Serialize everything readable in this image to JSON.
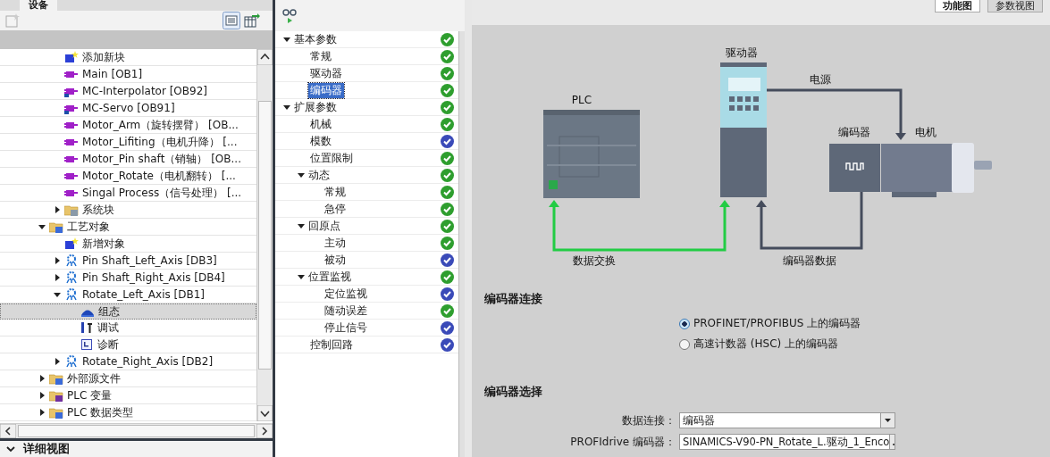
{
  "left_panel": {
    "tab": {
      "label": "设备",
      "selected": true
    },
    "tree": {
      "scrolled_children": [
        {
          "kind": "new-block",
          "label": "添加新块",
          "selected": false
        },
        {
          "kind": "ob",
          "label": "Main [OB1]",
          "selected": false
        },
        {
          "kind": "ob-locked",
          "label": "MC-Interpolator [OB92]",
          "selected": false
        },
        {
          "kind": "ob-locked",
          "label": "MC-Servo [OB91]",
          "selected": false
        },
        {
          "kind": "ob",
          "label": "Motor_Arm（旋转摆臂） [OB...",
          "selected": false
        },
        {
          "kind": "ob",
          "label": "Motor_Lifiting（电机升降） [...",
          "selected": false
        },
        {
          "kind": "ob",
          "label": "Motor_Pin shaft（销轴） [OB...",
          "selected": false
        },
        {
          "kind": "ob",
          "label": "Motor_Rotate（电机翻转） [...",
          "selected": false
        },
        {
          "kind": "ob",
          "label": "Singal Process（信号处理） [...",
          "selected": false
        },
        {
          "kind": "folder-system",
          "label": "系统块",
          "expanded": false,
          "selected": false
        }
      ],
      "items": [
        {
          "kind": "folder-tech",
          "label": "工艺对象",
          "expanded": true,
          "selected": false,
          "children": [
            {
              "kind": "new-object",
              "label": "新增对象",
              "selected": false
            },
            {
              "kind": "axis",
              "label": "Pin Shaft_Left_Axis [DB3]",
              "expanded": false,
              "selected": false
            },
            {
              "kind": "axis",
              "label": "Pin Shaft_Right_Axis [DB4]",
              "expanded": false,
              "selected": false
            },
            {
              "kind": "axis",
              "label": "Rotate_Left_Axis [DB1]",
              "expanded": true,
              "selected": false,
              "children": [
                {
                  "kind": "config",
                  "label": "组态",
                  "selected": true
                },
                {
                  "kind": "commission",
                  "label": "调试",
                  "selected": false
                },
                {
                  "kind": "diagnostics",
                  "label": "诊断",
                  "selected": false
                }
              ]
            },
            {
              "kind": "axis",
              "label": "Rotate_Right_Axis [DB2]",
              "expanded": false,
              "selected": false
            }
          ]
        },
        {
          "kind": "folder-ext",
          "label": "外部源文件",
          "expanded": false,
          "selected": false
        },
        {
          "kind": "folder-tags",
          "label": "PLC 变量",
          "expanded": false,
          "selected": false
        },
        {
          "kind": "folder-types",
          "label": "PLC 数据类型",
          "expanded": false,
          "selected": false
        }
      ]
    },
    "detail_view": {
      "label": "详细视图"
    }
  },
  "nav": [
    {
      "label": "基本参数",
      "expanded": true,
      "selected": false,
      "color": "#2e9e2e",
      "children": [
        {
          "label": "常规",
          "selected": false,
          "color": "#2e9e2e"
        },
        {
          "label": "驱动器",
          "selected": false,
          "color": "#2e9e2e"
        },
        {
          "label": "编码器",
          "selected": true,
          "color": "#2e9e2e"
        }
      ]
    },
    {
      "label": "扩展参数",
      "expanded": true,
      "selected": false,
      "color": "#2e9e2e",
      "children": [
        {
          "label": "机械",
          "selected": false,
          "color": "#2e9e2e"
        },
        {
          "label": "模数",
          "selected": false,
          "color": "#3a4ab8"
        },
        {
          "label": "位置限制",
          "selected": false,
          "color": "#2e9e2e"
        },
        {
          "label": "动态",
          "expanded": true,
          "selected": false,
          "color": "#2e9e2e",
          "children": [
            {
              "label": "常规",
              "selected": false,
              "color": "#2e9e2e"
            },
            {
              "label": "急停",
              "selected": false,
              "color": "#2e9e2e"
            }
          ]
        },
        {
          "label": "回原点",
          "expanded": true,
          "selected": false,
          "color": "#2e9e2e",
          "children": [
            {
              "label": "主动",
              "selected": false,
              "color": "#2e9e2e"
            },
            {
              "label": "被动",
              "selected": false,
              "color": "#3a4ab8"
            }
          ]
        },
        {
          "label": "位置监视",
          "expanded": true,
          "selected": false,
          "color": "#2e9e2e",
          "children": [
            {
              "label": "定位监视",
              "selected": false,
              "color": "#3a4ab8"
            },
            {
              "label": "随动误差",
              "selected": false,
              "color": "#2e9e2e"
            },
            {
              "label": "停止信号",
              "selected": false,
              "color": "#3a4ab8"
            }
          ]
        },
        {
          "label": "控制回路",
          "selected": false,
          "color": "#3a4ab8"
        }
      ]
    }
  ],
  "view_tabs": [
    {
      "label": "功能图",
      "selected": true
    },
    {
      "label": "参数视图",
      "selected": false
    }
  ],
  "diagram": {
    "plc": "PLC",
    "drive": "驱动器",
    "power": "电源",
    "encoder": "编码器",
    "motor": "电机",
    "data_exchange": "数据交换",
    "encoder_data": "编码器数据"
  },
  "encoder_connection": {
    "title": "编码器连接",
    "options": [
      {
        "label": "PROFINET/PROFIBUS 上的编码器",
        "selected": true
      },
      {
        "label": "高速计数器 (HSC) 上的编码器",
        "selected": false
      }
    ]
  },
  "encoder_selection": {
    "title": "编码器选择",
    "fields": [
      {
        "kind": "dropdown",
        "label": "数据连接：",
        "value": "编码器"
      },
      {
        "kind": "browse",
        "label": "PROFIdrive 编码器：",
        "value": "SINAMICS-V90-PN_Rotate_L.驱动_1_Enco"
      }
    ]
  }
}
